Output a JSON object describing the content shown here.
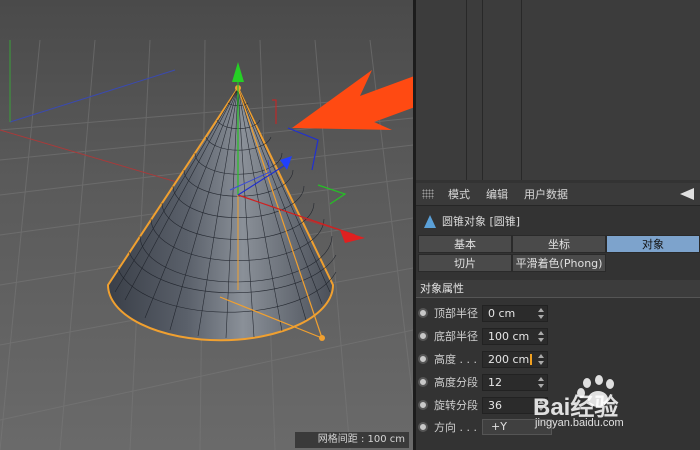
{
  "viewport": {
    "grid_spacing_text": "网格间距 : 100 cm"
  },
  "attribute_manager": {
    "menu": [
      "模式",
      "编辑",
      "用户数据"
    ],
    "object_title": "圆锥对象 [圆锥]",
    "tabs_row1": [
      {
        "label": "基本",
        "active": false
      },
      {
        "label": "坐标",
        "active": false
      },
      {
        "label": "对象",
        "active": true
      }
    ],
    "tabs_row2": [
      {
        "label": "切片",
        "active": false
      },
      {
        "label": "平滑着色(Phong)",
        "active": false
      }
    ],
    "section_title": "对象属性",
    "properties": [
      {
        "label": "顶部半径",
        "value": "0 cm",
        "kind": "number"
      },
      {
        "label": "底部半径",
        "value": "100 cm",
        "kind": "number"
      },
      {
        "label": "高度 . . .",
        "value": "200 cm",
        "kind": "number-editing"
      },
      {
        "label": "高度分段",
        "value": "12",
        "kind": "number"
      },
      {
        "label": "旋转分段",
        "value": "36",
        "kind": "number"
      },
      {
        "label": "方向 . . .",
        "value": "+Y",
        "kind": "dropdown"
      }
    ]
  },
  "watermark": {
    "brand": "Bai经验",
    "url": "jingyan.baidu.com"
  },
  "colors": {
    "accent_tab": "#7da3cc",
    "arrow": "#ff4a12",
    "selection_outline": "#f0a030"
  }
}
